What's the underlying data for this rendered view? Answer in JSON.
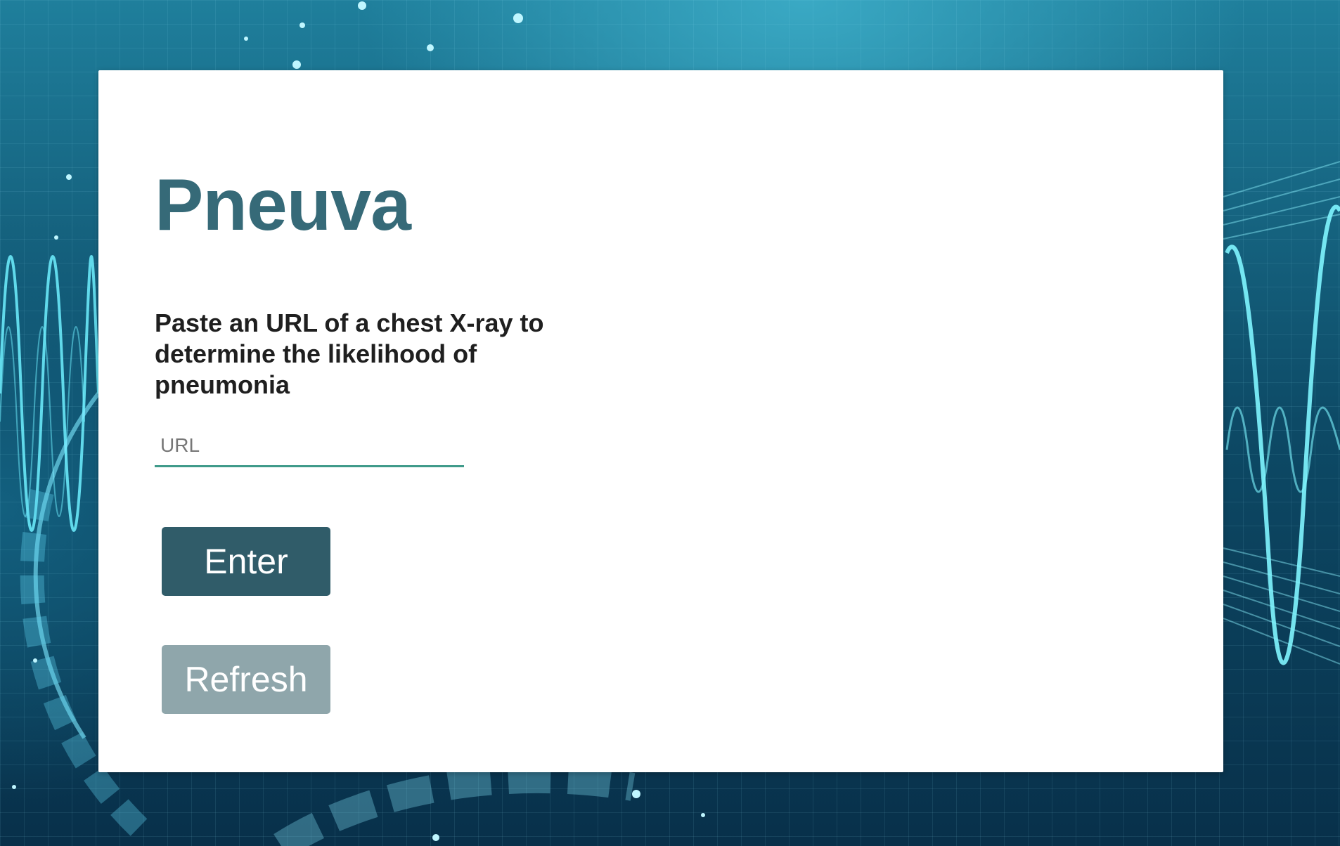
{
  "app": {
    "title": "Pneuva",
    "instructions": "Paste an URL of a chest X-ray to determine the likelihood of pneumonia"
  },
  "form": {
    "url_placeholder": "URL",
    "url_value": "",
    "enter_label": "Enter",
    "refresh_label": "Refresh"
  },
  "colors": {
    "title": "#366a78",
    "enter_button": "#305c69",
    "refresh_button": "#8fa6ab",
    "input_underline": "#3f9a8a"
  }
}
